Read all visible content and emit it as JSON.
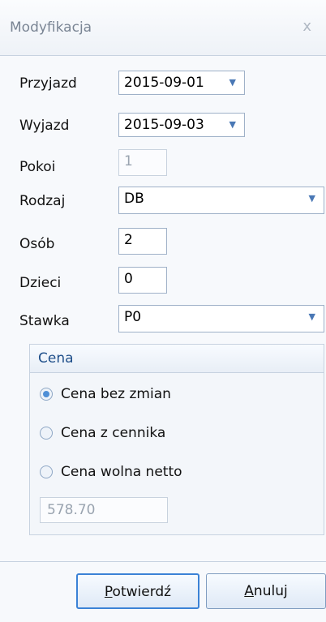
{
  "window": {
    "title": "Modyfikacja",
    "close_glyph": "x",
    "close_icon": "close-icon"
  },
  "form": {
    "przyjazd": {
      "label": "Przyjazd",
      "value": "2015-09-01"
    },
    "wyjazd": {
      "label": "Wyjazd",
      "value": "2015-09-03"
    },
    "pokoi": {
      "label": "Pokoi",
      "value": "1"
    },
    "rodzaj": {
      "label": "Rodzaj",
      "value": "DB"
    },
    "osob": {
      "label": "Osób",
      "value": "2"
    },
    "dzieci": {
      "label": "Dzieci",
      "value": "0"
    },
    "stawka": {
      "label": "Stawka",
      "value": "P0"
    }
  },
  "cena": {
    "group_title": "Cena",
    "options": [
      {
        "label": "Cena bez zmian",
        "checked": true
      },
      {
        "label": "Cena z cennika",
        "checked": false
      },
      {
        "label": "Cena wolna netto",
        "checked": false
      }
    ],
    "netto_value": "578.70"
  },
  "buttons": {
    "confirm": {
      "mnemonic": "P",
      "rest": "otwierdź"
    },
    "cancel": {
      "mnemonic": "A",
      "rest": "nuluj"
    }
  },
  "icons": {
    "dropdown": "chevron-down-icon"
  },
  "colors": {
    "accent": "#3b82d6",
    "group_title": "#1f4f8a",
    "border": "#c7d2e0"
  }
}
